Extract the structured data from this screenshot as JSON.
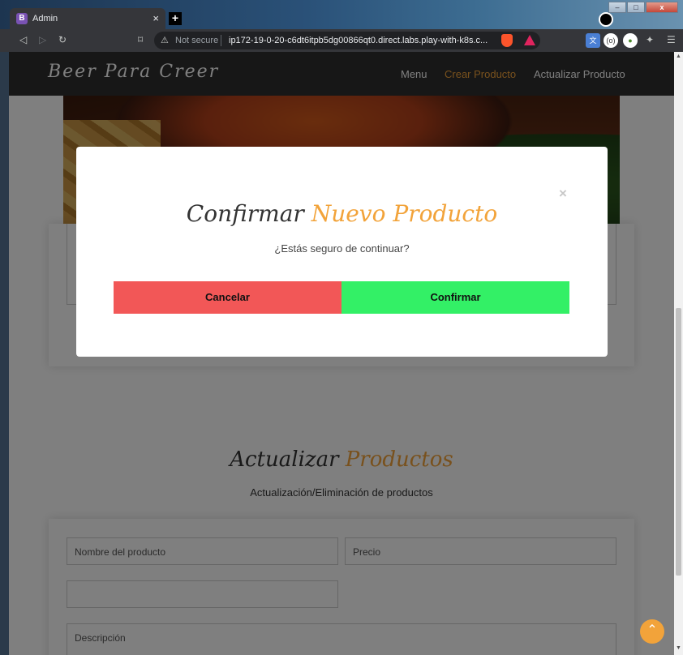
{
  "browser": {
    "tab_favicon": "B",
    "tab_title": "Admin",
    "tab_close": "×",
    "new_tab": "+",
    "security_label": "Not secure",
    "url": "ip172-19-0-20-c6dt6itpb5dg00866qt0.direct.labs.play-with-k8s.c...",
    "window_controls": [
      "–",
      "□",
      "x"
    ]
  },
  "header": {
    "logo": "Beer Para Creer",
    "nav": [
      "Menu",
      "Crear Producto",
      "Actualizar Producto"
    ],
    "active_nav": "Crear Producto"
  },
  "modal": {
    "title_part1": "Confirmar",
    "title_part2": "Nuevo Producto",
    "message": "¿Estás seguro de continuar?",
    "cancel_label": "Cancelar",
    "confirm_label": "Confirmar",
    "close_symbol": "×"
  },
  "update_section": {
    "title_part1": "Actualizar",
    "title_part2": "Productos",
    "subtitle": "Actualización/Eliminación de productos",
    "fields": {
      "name_placeholder": "Nombre del producto",
      "price_placeholder": "Precio",
      "extra_value": "",
      "description_placeholder": "Descripción"
    }
  },
  "colors": {
    "accent": "#f2a33a",
    "cancel": "#f25757",
    "confirm": "#33f066",
    "header_bg": "#2e2e2e"
  }
}
